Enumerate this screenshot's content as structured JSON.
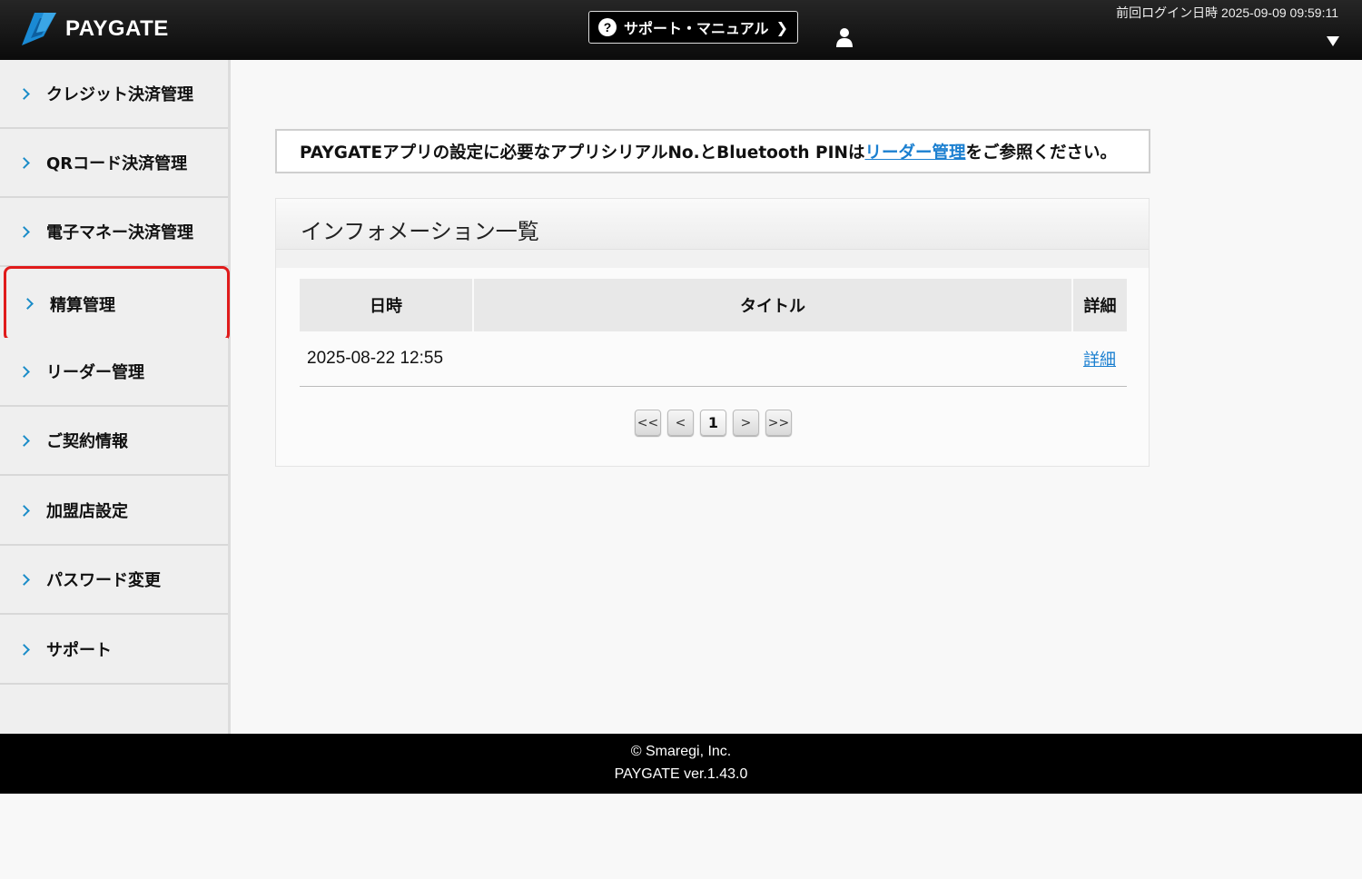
{
  "header": {
    "logo_text": "PAYGATE",
    "support_label": "サポート・マニュアル",
    "support_icon": "question-circle-icon",
    "last_login": "前回ログイン日時 2025-09-09 09:59:11",
    "user_icon": "user-icon",
    "dropdown_icon": "triangle-down-icon"
  },
  "sidebar": {
    "items": [
      {
        "label": "クレジット決済管理"
      },
      {
        "label": "QRコード決済管理"
      },
      {
        "label": "電子マネー決済管理"
      },
      {
        "label": "精算管理",
        "highlighted": true
      },
      {
        "label": "リーダー管理"
      },
      {
        "label": "ご契約情報"
      },
      {
        "label": "加盟店設定"
      },
      {
        "label": "パスワード変更"
      },
      {
        "label": "サポート"
      }
    ],
    "highlight_color": "#e01b1b",
    "chevron_color": "#1a8cc8"
  },
  "notice": {
    "before": "PAYGATEアプリの設定に必要なアプリシリアルNo.とBluetooth PINは",
    "link": "リーダー管理",
    "after": "をご参照ください。"
  },
  "info": {
    "title": "インフォメーション一覧",
    "columns": [
      "日時",
      "タイトル",
      "詳細"
    ],
    "rows": [
      {
        "date": "2025-08-22 12:55",
        "title": "",
        "detail": "詳細"
      }
    ],
    "pagination": {
      "first": "<<",
      "prev": "<",
      "current": "1",
      "next": ">",
      "last": ">>"
    }
  },
  "footer": {
    "copyright": "© Smaregi, Inc.",
    "version": "PAYGATE ver.1.43.0"
  },
  "colors": {
    "link": "#1a7fd0",
    "header_bg": "#111111"
  }
}
